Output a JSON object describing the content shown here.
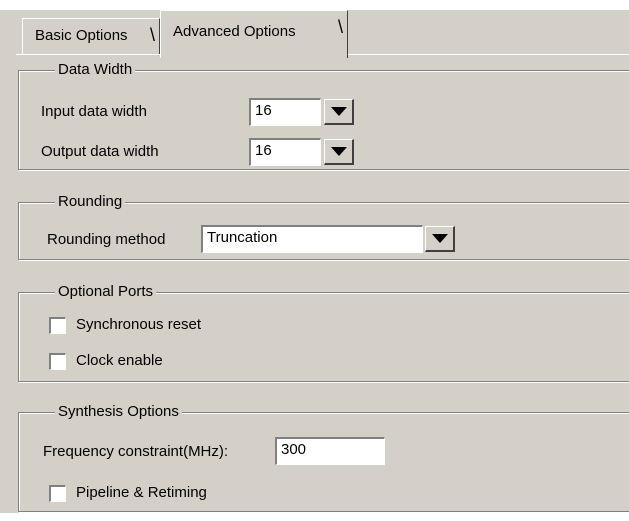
{
  "tabs": [
    {
      "label": "Basic Options",
      "active": false
    },
    {
      "label": "Advanced Options",
      "active": true
    }
  ],
  "data_width": {
    "title": "Data Width",
    "input_label": "Input data width",
    "input_value": "16",
    "output_label": "Output data width",
    "output_value": "16"
  },
  "rounding": {
    "title": "Rounding",
    "method_label": "Rounding method",
    "method_value": "Truncation"
  },
  "optional_ports": {
    "title": "Optional Ports",
    "sync_reset_label": "Synchronous reset",
    "sync_reset_checked": false,
    "clock_enable_label": "Clock enable",
    "clock_enable_checked": false
  },
  "synthesis": {
    "title": "Synthesis Options",
    "freq_label": "Frequency constraint(MHz):",
    "freq_value": "300",
    "pipeline_label": "Pipeline & Retiming",
    "pipeline_checked": false
  },
  "colors": {
    "face": "#d4d0c8",
    "shadow": "#808080",
    "highlight": "#ffffff"
  }
}
